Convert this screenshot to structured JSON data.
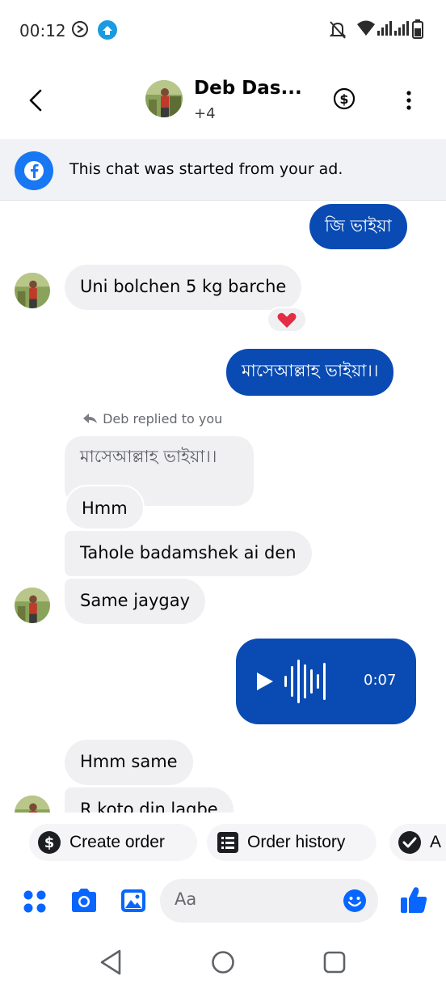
{
  "status_bar": {
    "time": "00:12",
    "icons": [
      "whatsapp-call-icon",
      "app-notification-icon",
      "bell-off-icon",
      "wifi-icon",
      "signal-icon",
      "battery-icon"
    ]
  },
  "header": {
    "contact_name": "Deb Das...",
    "participants_extra": "+4",
    "icons": [
      "back-arrow-icon",
      "dollar-icon",
      "more-vertical-icon"
    ]
  },
  "banner": {
    "text": "This chat was started from your ad.",
    "icon": "facebook-icon"
  },
  "messages": [
    {
      "id": "m1",
      "direction": "outgoing",
      "text": "জি ভাইয়া"
    },
    {
      "id": "m2",
      "direction": "incoming",
      "text": "Uni bolchen 5 kg barche",
      "reaction": "heart"
    },
    {
      "id": "m3",
      "direction": "outgoing",
      "text": "মাসেআল্লাহ ভাইয়া।।"
    },
    {
      "id": "m4",
      "direction": "incoming",
      "reply_label": "Deb replied to you",
      "quoted_text": "মাসেআল্লাহ ভাইয়া।।",
      "text": "Hmm"
    },
    {
      "id": "m5",
      "direction": "incoming",
      "text": "Tahole badamshek ai den"
    },
    {
      "id": "m6",
      "direction": "incoming",
      "text": "Same jaygay"
    },
    {
      "id": "m7",
      "direction": "outgoing",
      "type": "voice",
      "duration": "0:07"
    },
    {
      "id": "m8",
      "direction": "incoming",
      "text": "Hmm same"
    },
    {
      "id": "m9",
      "direction": "incoming",
      "text": "R koto din lagbe"
    }
  ],
  "quick_actions": [
    {
      "label": "Create order",
      "icon": "dollar-circle-icon"
    },
    {
      "label": "Order history",
      "icon": "receipt-list-icon"
    },
    {
      "label": "A",
      "icon": "check-circle-icon"
    }
  ],
  "composer": {
    "placeholder": "Aa",
    "icons": [
      "apps-grid-icon",
      "camera-icon",
      "gallery-icon",
      "emoji-icon",
      "thumbs-up-icon"
    ]
  },
  "colors": {
    "outgoing_bubble": "#0a4bb3",
    "incoming_bubble": "#f0f0f2",
    "accent": "#1877f2",
    "banner_bg": "#f0f2f5"
  }
}
